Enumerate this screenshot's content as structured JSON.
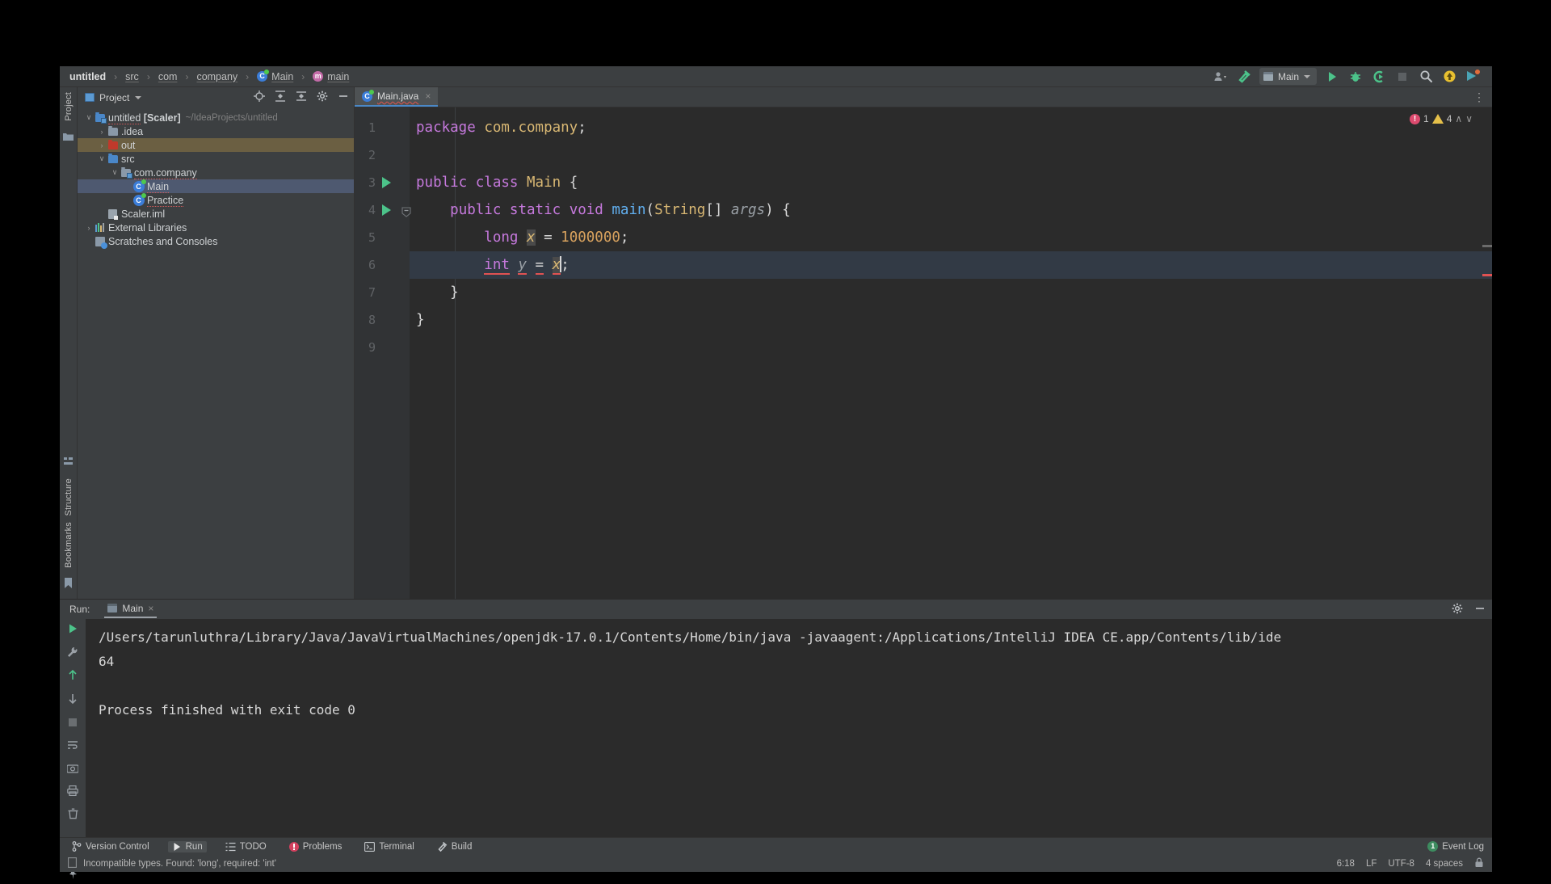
{
  "breadcrumb": {
    "items": [
      {
        "label": "untitled",
        "icon": "none",
        "bold": true
      },
      {
        "label": "src",
        "icon": "none",
        "bold": false
      },
      {
        "label": "com",
        "icon": "none",
        "bold": false
      },
      {
        "label": "company",
        "icon": "none",
        "bold": false
      },
      {
        "label": "Main",
        "icon": "class-icon",
        "bold": false
      },
      {
        "label": "main",
        "icon": "method-icon",
        "bold": false
      }
    ],
    "separator": "›"
  },
  "toolbar": {
    "user_icon": "user-dropdown-icon",
    "build_icon": "build-hammer-icon",
    "run_config": "Main",
    "run_icon": "run-icon",
    "debug_icon": "debug-icon",
    "coverage_icon": "run-with-coverage-icon",
    "stop_icon": "stop-icon",
    "search_icon": "search-everywhere-icon",
    "update_icon": "update-project-icon",
    "notification_icon": "notifications-icon"
  },
  "left_rail": {
    "project_label": "Project",
    "structure_label": "Structure",
    "bookmarks_label": "Bookmarks"
  },
  "project_panel": {
    "title": "Project",
    "tools": [
      "locate-icon",
      "expand-all-icon",
      "collapse-all-icon",
      "settings-gear-icon",
      "hide-icon"
    ],
    "tree": [
      {
        "label": "untitled [Scaler]",
        "suffix": "~/IdeaProjects/untitled",
        "indent": 0,
        "arrow": "down",
        "icon": "module-folder-icon",
        "state": "normal",
        "bold_part": "[Scaler]"
      },
      {
        "label": ".idea",
        "suffix": "",
        "indent": 1,
        "arrow": "right",
        "icon": "folder-icon",
        "state": "normal"
      },
      {
        "label": "out",
        "suffix": "",
        "indent": 1,
        "arrow": "right",
        "icon": "excluded-folder-icon",
        "state": "highlight"
      },
      {
        "label": "src",
        "suffix": "",
        "indent": 1,
        "arrow": "down",
        "icon": "source-folder-icon",
        "state": "normal"
      },
      {
        "label": "com.company",
        "suffix": "",
        "indent": 2,
        "arrow": "down",
        "icon": "package-icon",
        "state": "normal"
      },
      {
        "label": "Main",
        "suffix": "",
        "indent": 3,
        "arrow": "none",
        "icon": "class-icon",
        "state": "selected"
      },
      {
        "label": "Practice",
        "suffix": "",
        "indent": 3,
        "arrow": "none",
        "icon": "class-icon",
        "state": "normal"
      },
      {
        "label": "Scaler.iml",
        "suffix": "",
        "indent": 1,
        "arrow": "none",
        "icon": "iml-file-icon",
        "state": "normal"
      },
      {
        "label": "External Libraries",
        "suffix": "",
        "indent": 0,
        "arrow": "right",
        "icon": "libraries-icon",
        "state": "normal"
      },
      {
        "label": "Scratches and Consoles",
        "suffix": "",
        "indent": 0,
        "arrow": "none",
        "icon": "scratches-icon",
        "state": "normal"
      }
    ]
  },
  "editor": {
    "tab": {
      "label": "Main.java",
      "icon": "java-class-icon",
      "close": "×"
    },
    "options_icon": "editor-options-icon",
    "inspection": {
      "error_count": "1",
      "warning_count": "4",
      "up": "∧",
      "down": "∨"
    },
    "lines": [
      {
        "no": "1",
        "tokens": [
          {
            "t": "package",
            "c": "pk"
          },
          {
            "t": " ",
            "c": "plain"
          },
          {
            "t": "com.company",
            "c": "str"
          },
          {
            "t": ";",
            "c": "plain"
          }
        ]
      },
      {
        "no": "2",
        "tokens": []
      },
      {
        "no": "3",
        "gutter_run": true,
        "tokens": [
          {
            "t": "public",
            "c": "pk"
          },
          {
            "t": " ",
            "c": "plain"
          },
          {
            "t": "class",
            "c": "pk"
          },
          {
            "t": " ",
            "c": "plain"
          },
          {
            "t": "Main",
            "c": "str"
          },
          {
            "t": " {",
            "c": "plain"
          }
        ]
      },
      {
        "no": "4",
        "gutter_run": true,
        "gutter_fold": true,
        "tokens": [
          {
            "t": "    ",
            "c": "plain"
          },
          {
            "t": "public",
            "c": "pk"
          },
          {
            "t": " ",
            "c": "plain"
          },
          {
            "t": "static",
            "c": "pk"
          },
          {
            "t": " ",
            "c": "plain"
          },
          {
            "t": "void",
            "c": "pk"
          },
          {
            "t": " ",
            "c": "plain"
          },
          {
            "t": "main",
            "c": "meth"
          },
          {
            "t": "(",
            "c": "plain"
          },
          {
            "t": "String",
            "c": "str"
          },
          {
            "t": "[] ",
            "c": "plain"
          },
          {
            "t": "args",
            "c": "param"
          },
          {
            "t": ") {",
            "c": "plain"
          }
        ]
      },
      {
        "no": "5",
        "tokens": [
          {
            "t": "        ",
            "c": "plain"
          },
          {
            "t": "long",
            "c": "pk"
          },
          {
            "t": " ",
            "c": "plain"
          },
          {
            "t": "x",
            "c": "lvar sel-token"
          },
          {
            "t": " = ",
            "c": "plain"
          },
          {
            "t": "1000000",
            "c": "num"
          },
          {
            "t": ";",
            "c": "plain"
          }
        ]
      },
      {
        "no": "6",
        "current": true,
        "gutter_bulb": true,
        "tokens": [
          {
            "t": "        ",
            "c": "plain"
          },
          {
            "t": "int",
            "c": "pk err-underline"
          },
          {
            "t": " ",
            "c": "plain"
          },
          {
            "t": "y",
            "c": "param err-underline"
          },
          {
            "t": " ",
            "c": "plain"
          },
          {
            "t": "=",
            "c": "plain err-underline"
          },
          {
            "t": " ",
            "c": "plain"
          },
          {
            "t": "x",
            "c": "lvar sel-token err-underline"
          },
          {
            "t": ";",
            "c": "plain"
          }
        ]
      },
      {
        "no": "7",
        "gutter_fold_end": true,
        "tokens": [
          {
            "t": "    }",
            "c": "plain"
          }
        ]
      },
      {
        "no": "8",
        "tokens": [
          {
            "t": "}",
            "c": "plain"
          }
        ]
      },
      {
        "no": "9",
        "tokens": []
      }
    ]
  },
  "run_panel": {
    "label": "Run:",
    "tab": "Main",
    "tab_close": "×",
    "settings_icon": "settings-gear-icon",
    "hide_icon": "hide-icon",
    "tools": [
      "rerun-icon",
      "wrench-icon",
      "scroll-up-icon",
      "scroll-down-icon",
      "stop-icon",
      "soft-wrap-icon",
      "camera-icon",
      "print-icon",
      "clear-all-icon",
      "console-icon",
      "pin-icon"
    ],
    "console_lines": [
      "/Users/tarunluthra/Library/Java/JavaVirtualMachines/openjdk-17.0.1/Contents/Home/bin/java -javaagent:/Applications/IntelliJ IDEA CE.app/Contents/lib/ide",
      "64",
      "",
      "Process finished with exit code 0"
    ]
  },
  "tool_window_bar": {
    "items": [
      {
        "label": "Version Control",
        "icon": "branch-icon",
        "active": false
      },
      {
        "label": "Run",
        "icon": "run-icon",
        "active": true
      },
      {
        "label": "TODO",
        "icon": "todo-icon",
        "active": false
      },
      {
        "label": "Problems",
        "icon": "problems-icon",
        "active": false
      },
      {
        "label": "Terminal",
        "icon": "terminal-icon",
        "active": false
      },
      {
        "label": "Build",
        "icon": "build-hammer-icon",
        "active": false
      }
    ],
    "event_log": {
      "label": "Event Log",
      "count": "1"
    }
  },
  "status_bar": {
    "message": "Incompatible types. Found: 'long', required: 'int'",
    "message_icon": "info-icon",
    "position": "6:18",
    "line_separator": "LF",
    "encoding": "UTF-8",
    "indent": "4 spaces",
    "lock_icon": "read-only-icon"
  },
  "colors": {
    "panel_bg": "#3c3f41",
    "editor_bg": "#2b2b2b",
    "accent_blue": "#4a88c7",
    "keyword_purple": "#c679dd",
    "string_gold": "#d8b773",
    "method_blue": "#61afef",
    "error_red": "#e05252",
    "run_green": "#4cc38a",
    "selection_blue": "#4e5970",
    "highlight_tan": "#6b5f42"
  }
}
